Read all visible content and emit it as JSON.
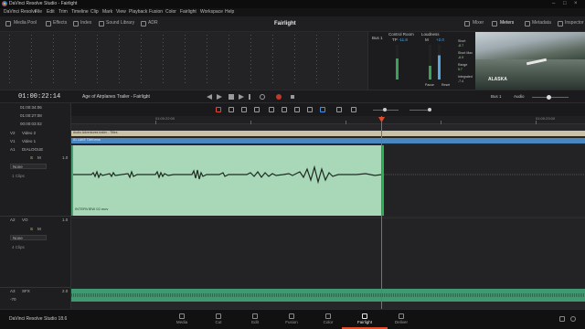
{
  "window": {
    "title": "DaVinci Resolve Studio - Fairlight"
  },
  "menu": [
    "DaVinci Resolve",
    "File",
    "Edit",
    "Trim",
    "Timeline",
    "Clip",
    "Mark",
    "View",
    "Playback",
    "Fusion",
    "Color",
    "Fairlight",
    "Workspace",
    "Help"
  ],
  "toolbar": {
    "left": [
      "Media Pool",
      "Effects",
      "Index",
      "Sound Library",
      "ADR"
    ],
    "page_title": "Fairlight",
    "right": [
      "Mixer",
      "Meters",
      "Metadata",
      "Inspector"
    ]
  },
  "control_room": {
    "bus": "Bus 1",
    "label": "Control Room",
    "loudness": "Loudness",
    "tp_label": "TP",
    "tp_value": "-11.8",
    "m_label": "M",
    "loud_value": "+2.0",
    "stats": [
      {
        "label": "Short",
        "value": "-8.7"
      },
      {
        "label": "Short Max",
        "value": "-6.9"
      },
      {
        "label": "Range",
        "value": "5.7"
      },
      {
        "label": "Integrated",
        "value": "-7.4"
      }
    ],
    "buttons": [
      "Pause",
      "Reset"
    ]
  },
  "viewer": {
    "overlay_text": "ALASKA"
  },
  "transport": {
    "timecode": "01:00:22:14",
    "timeline_name": "Age of Airplanes Trailer - Fairlight",
    "right_labels": [
      "Bus 1",
      "Audio"
    ]
  },
  "ruler": {
    "labels": [
      "01:00:22:00",
      "01:00:23:00"
    ]
  },
  "headers": {
    "timecodes": [
      "01:00:34:06",
      "01:00:27:08",
      "00:00:03:02"
    ],
    "tracks": [
      {
        "id": "V2",
        "name": "Video 2"
      },
      {
        "id": "V1",
        "name": "Video 1"
      },
      {
        "id": "A1",
        "name": "DIALOGUE",
        "mode": "None",
        "clips": "1 Clips",
        "gain": "1.0"
      },
      {
        "id": "A2",
        "name": "VO",
        "mode": "None",
        "clips": "4 Clips",
        "gain": "1.0"
      },
      {
        "id": "A3",
        "name": "SFX",
        "gain": "2.0",
        "level": "-70"
      }
    ],
    "solo_mute": [
      "S",
      "M"
    ]
  },
  "clips": {
    "v2": "Audio Adventures trailer - Titles",
    "v1": "01 LAKE TAHI.mov",
    "a1": "INTERVIEW 02.mov"
  },
  "pages": [
    "Media",
    "Cut",
    "Edit",
    "Fusion",
    "Color",
    "Fairlight",
    "Deliver"
  ],
  "active_page": "Fairlight",
  "brand": "DaVinci Resolve Studio 18.6",
  "colors": {
    "accent": "#e04b2a",
    "clip_green": "#a8d8b8",
    "clip_blue": "#4a86c0"
  }
}
